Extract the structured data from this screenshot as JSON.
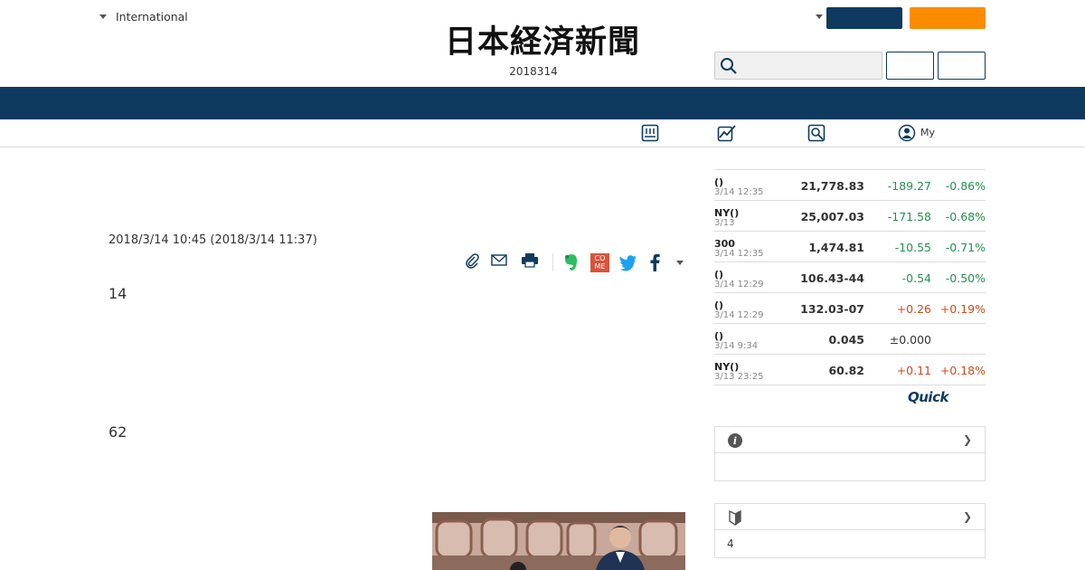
{
  "header": {
    "edition_label": "International",
    "masthead": "日本経済新聞",
    "date": "2018314",
    "search_placeholder": "",
    "my_label": "My"
  },
  "article": {
    "timestamp": "2018/3/14 10:45 (2018/3/14 11:37)",
    "paragraphs": [
      "14",
      "62"
    ]
  },
  "market": {
    "rows": [
      {
        "name": "()",
        "time": "3/14 12:35",
        "value": "21,778.83",
        "change": "-189.27",
        "percent": "-0.86%",
        "dir": "neg"
      },
      {
        "name": "NY()",
        "time": "3/13",
        "value": "25,007.03",
        "change": "-171.58",
        "percent": "-0.68%",
        "dir": "neg"
      },
      {
        "name": "300",
        "time": "3/14 12:35",
        "value": "1,474.81",
        "change": "-10.55",
        "percent": "-0.71%",
        "dir": "neg"
      },
      {
        "name": "()",
        "time": "3/14 12:29",
        "value": "106.43-44",
        "change": "-0.54",
        "percent": "-0.50%",
        "dir": "neg"
      },
      {
        "name": "()",
        "time": "3/14 12:29",
        "value": "132.03-07",
        "change": "+0.26",
        "percent": "+0.19%",
        "dir": "pos"
      },
      {
        "name": "()",
        "time": "3/14 9:34",
        "value": "0.045",
        "change": "±0.000",
        "percent": "",
        "dir": "flat"
      },
      {
        "name": "NY()",
        "time": "3/13 23:25",
        "value": "60.82",
        "change": "+0.11",
        "percent": "+0.18%",
        "dir": "pos"
      }
    ],
    "provider": "Quick"
  },
  "boxes": {
    "box2_text": "4"
  },
  "colors": {
    "navy": "#0f3a5f",
    "orange": "#fb8c00",
    "negative": "#25914e",
    "positive": "#d0491a"
  }
}
